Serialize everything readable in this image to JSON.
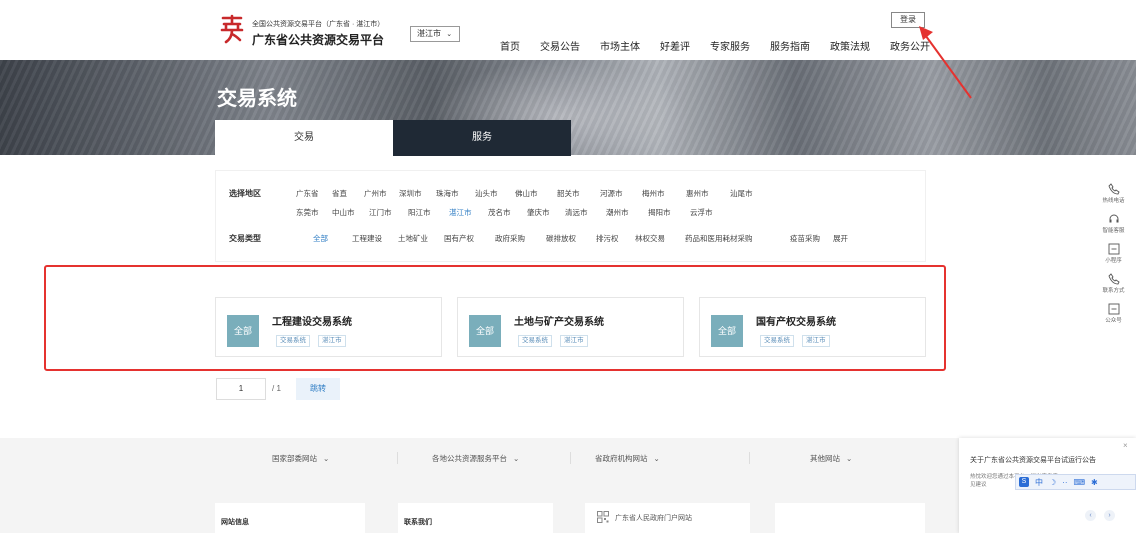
{
  "header": {
    "site_small": "全国公共资源交易平台（广东省 · 湛江市）",
    "site_title": "广东省公共资源交易平台",
    "city_select": "湛江市",
    "nav": [
      "首页",
      "交易公告",
      "市场主体",
      "好差评",
      "专家服务",
      "服务指南",
      "政策法规",
      "政务公开"
    ],
    "login": "登录"
  },
  "banner": {
    "title": "交易系统",
    "tabs": [
      "交易",
      "服务"
    ]
  },
  "filter": {
    "region_label": "选择地区",
    "regions_row1": [
      "广东省",
      "省直",
      "广州市",
      "深圳市",
      "珠海市",
      "汕头市",
      "佛山市",
      "韶关市",
      "河源市",
      "梅州市",
      "惠州市",
      "汕尾市"
    ],
    "regions_row2": [
      "东莞市",
      "中山市",
      "江门市",
      "阳江市",
      "湛江市",
      "茂名市",
      "肇庆市",
      "清远市",
      "潮州市",
      "揭阳市",
      "云浮市"
    ],
    "active_region": "湛江市",
    "type_label": "交易类型",
    "types": [
      "全部",
      "工程建设",
      "土地矿业",
      "国有产权",
      "政府采购",
      "碳排放权",
      "排污权",
      "林权交易",
      "药品和医用耗材采购",
      "疫苗采购",
      "展开"
    ],
    "active_type": "全部"
  },
  "cards": [
    {
      "badge": "全部",
      "title": "工程建设交易系统",
      "tags": [
        "交易系统",
        "湛江市"
      ]
    },
    {
      "badge": "全部",
      "title": "土地与矿产交易系统",
      "tags": [
        "交易系统",
        "湛江市"
      ]
    },
    {
      "badge": "全部",
      "title": "国有产权交易系统",
      "tags": [
        "交易系统",
        "湛江市"
      ]
    }
  ],
  "pagination": {
    "page": "1",
    "total": "/ 1",
    "jump": "跳转"
  },
  "footer": {
    "links": [
      "国家部委网站",
      "各地公共资源服务平台",
      "省政府机构网站",
      "其他网站"
    ],
    "boxes": [
      "网站信息",
      "联系我们",
      "广东省人民政府门户网站"
    ]
  },
  "side_toolbar": [
    "热线电话",
    "智能客服",
    "小程序",
    "联系方式",
    "公众号"
  ],
  "notice": {
    "title": "关于广东省公共资源交易平台试运行公告",
    "body_line1": "热忱欢迎您通过本平台，提出宝贵意",
    "body_line2": "见建议",
    "ime": [
      "中",
      "·",
      "··",
      "⌨",
      "✱"
    ]
  },
  "colors": {
    "accent": "#2f7dc4",
    "badge": "#7aaebb",
    "annotation_red": "#e5322f",
    "tab_dark": "#1f2935"
  }
}
